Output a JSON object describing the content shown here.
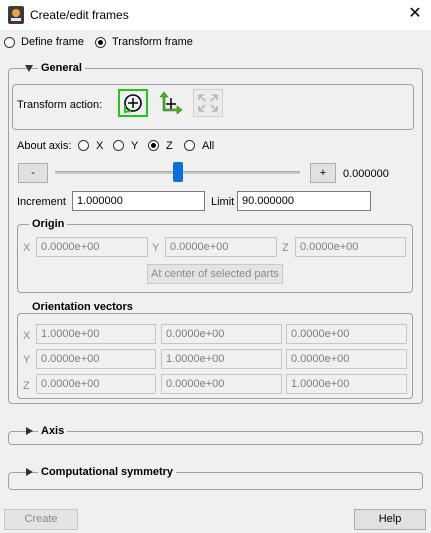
{
  "window": {
    "title": "Create/edit frames"
  },
  "mode": {
    "define": "Define frame",
    "transform": "Transform frame",
    "selected": "transform"
  },
  "general": {
    "label": "General",
    "transform_action_label": "Transform action:",
    "actions": [
      "rotate-icon",
      "translate-icon",
      "scale-icon"
    ],
    "about_axis_label": "About axis:",
    "axes": [
      "X",
      "Y",
      "Z",
      "All"
    ],
    "selected_axis": "Z",
    "minus": "-",
    "plus": "+",
    "slider_value": "0.000000",
    "slider_fraction": 0.5,
    "increment_label": "Increment",
    "increment_value": "1.000000",
    "limit_label": "Limit",
    "limit_value": "90.000000"
  },
  "origin": {
    "label": "Origin",
    "x_label": "X",
    "x_value": "0.0000e+00",
    "y_label": "Y",
    "y_value": "0.0000e+00",
    "z_label": "Z",
    "z_value": "0.0000e+00",
    "center_button": "At center of selected parts"
  },
  "orientation": {
    "label": "Orientation vectors",
    "rows": [
      {
        "label": "X",
        "values": [
          "1.0000e+00",
          "0.0000e+00",
          "0.0000e+00"
        ]
      },
      {
        "label": "Y",
        "values": [
          "0.0000e+00",
          "1.0000e+00",
          "0.0000e+00"
        ]
      },
      {
        "label": "Z",
        "values": [
          "0.0000e+00",
          "0.0000e+00",
          "1.0000e+00"
        ]
      }
    ]
  },
  "axis_section": {
    "label": "Axis"
  },
  "symmetry_section": {
    "label": "Computational symmetry"
  },
  "footer": {
    "create": "Create",
    "help": "Help"
  },
  "colors": {
    "rotate_active": "#22c21f",
    "move_arrows": "#4caf2a",
    "slider": "#0a6fd6"
  }
}
